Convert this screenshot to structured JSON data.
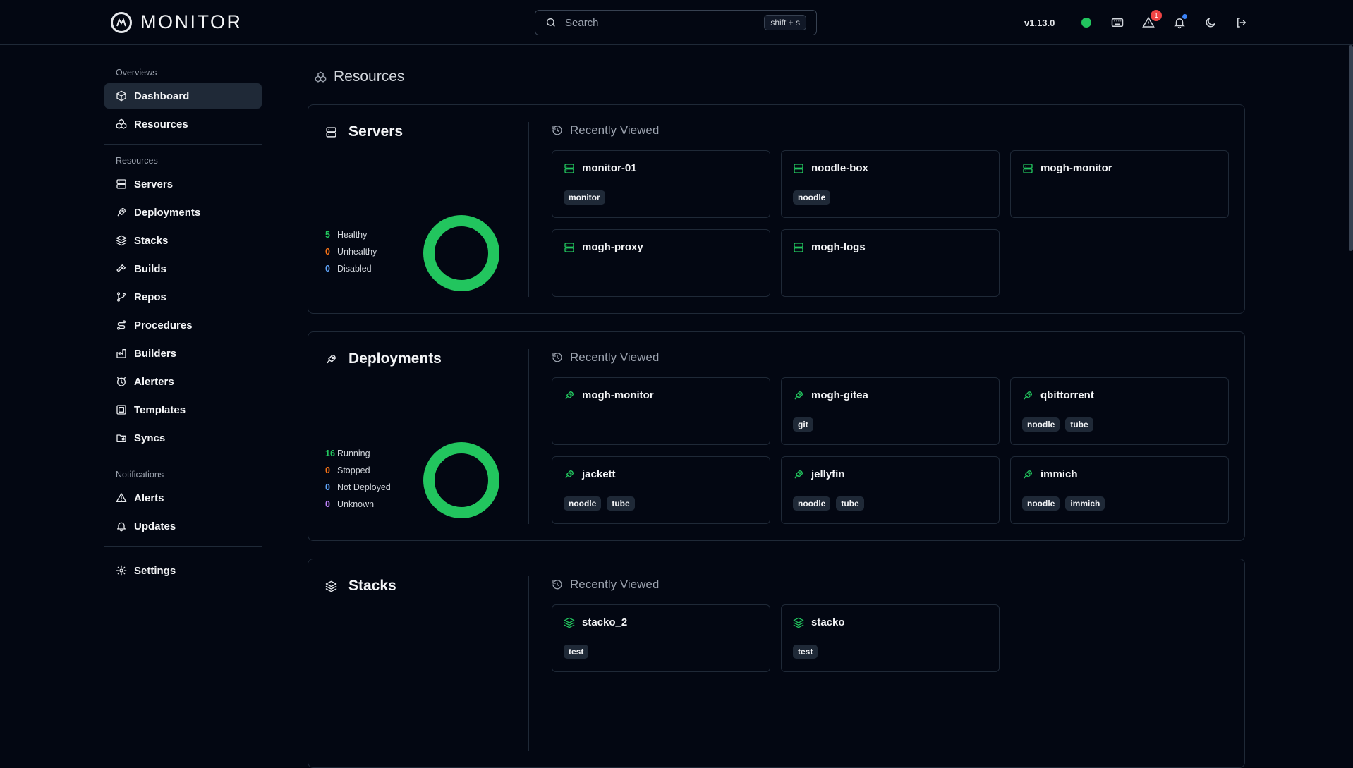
{
  "app": {
    "name": "MONITOR",
    "version": "v1.13.0"
  },
  "search": {
    "placeholder": "Search",
    "shortcut": "shift + s"
  },
  "header": {
    "alerts_count": "1",
    "status_color": "#22c55e"
  },
  "sidebar": {
    "groups": [
      {
        "label": "Overviews",
        "items": [
          {
            "label": "Dashboard",
            "icon": "box-icon",
            "active": true
          },
          {
            "label": "Resources",
            "icon": "boxes-icon"
          }
        ]
      },
      {
        "label": "Resources",
        "items": [
          {
            "label": "Servers",
            "icon": "server-icon"
          },
          {
            "label": "Deployments",
            "icon": "rocket-icon"
          },
          {
            "label": "Stacks",
            "icon": "layers-icon"
          },
          {
            "label": "Builds",
            "icon": "hammer-icon"
          },
          {
            "label": "Repos",
            "icon": "git-branch-icon"
          },
          {
            "label": "Procedures",
            "icon": "route-icon"
          },
          {
            "label": "Builders",
            "icon": "factory-icon"
          },
          {
            "label": "Alerters",
            "icon": "alarm-icon"
          },
          {
            "label": "Templates",
            "icon": "template-icon"
          },
          {
            "label": "Syncs",
            "icon": "folder-sync-icon"
          }
        ]
      },
      {
        "label": "Notifications",
        "items": [
          {
            "label": "Alerts",
            "icon": "alert-triangle-icon"
          },
          {
            "label": "Updates",
            "icon": "bell-icon"
          }
        ]
      },
      {
        "label": "",
        "items": [
          {
            "label": "Settings",
            "icon": "gear-icon"
          }
        ]
      }
    ]
  },
  "main": {
    "title": "Resources",
    "recent_label": "Recently Viewed",
    "sections": {
      "servers": {
        "title": "Servers",
        "stats": [
          {
            "count": "5",
            "label": "Healthy",
            "color": "#22c55e"
          },
          {
            "count": "0",
            "label": "Unhealthy",
            "color": "#f97316"
          },
          {
            "count": "0",
            "label": "Disabled",
            "color": "#60a5fa"
          }
        ],
        "cards": [
          {
            "name": "monitor-01",
            "tags": [
              "monitor"
            ]
          },
          {
            "name": "noodle-box",
            "tags": [
              "noodle"
            ]
          },
          {
            "name": "mogh-monitor",
            "tags": []
          },
          {
            "name": "mogh-proxy",
            "tags": []
          },
          {
            "name": "mogh-logs",
            "tags": []
          }
        ]
      },
      "deployments": {
        "title": "Deployments",
        "stats": [
          {
            "count": "16",
            "label": "Running",
            "color": "#22c55e"
          },
          {
            "count": "0",
            "label": "Stopped",
            "color": "#f97316"
          },
          {
            "count": "0",
            "label": "Not Deployed",
            "color": "#60a5fa"
          },
          {
            "count": "0",
            "label": "Unknown",
            "color": "#c084fc"
          }
        ],
        "cards": [
          {
            "name": "mogh-monitor",
            "tags": []
          },
          {
            "name": "mogh-gitea",
            "tags": [
              "git"
            ]
          },
          {
            "name": "qbittorrent",
            "tags": [
              "noodle",
              "tube"
            ]
          },
          {
            "name": "jackett",
            "tags": [
              "noodle",
              "tube"
            ]
          },
          {
            "name": "jellyfin",
            "tags": [
              "noodle",
              "tube"
            ]
          },
          {
            "name": "immich",
            "tags": [
              "noodle",
              "immich"
            ]
          }
        ]
      },
      "stacks": {
        "title": "Stacks",
        "cards": [
          {
            "name": "stacko_2",
            "tags": [
              "test"
            ]
          },
          {
            "name": "stacko",
            "tags": [
              "test"
            ]
          }
        ]
      }
    }
  },
  "colors": {
    "accent_green": "#22c55e",
    "background": "#030712",
    "border": "#1f2937"
  }
}
